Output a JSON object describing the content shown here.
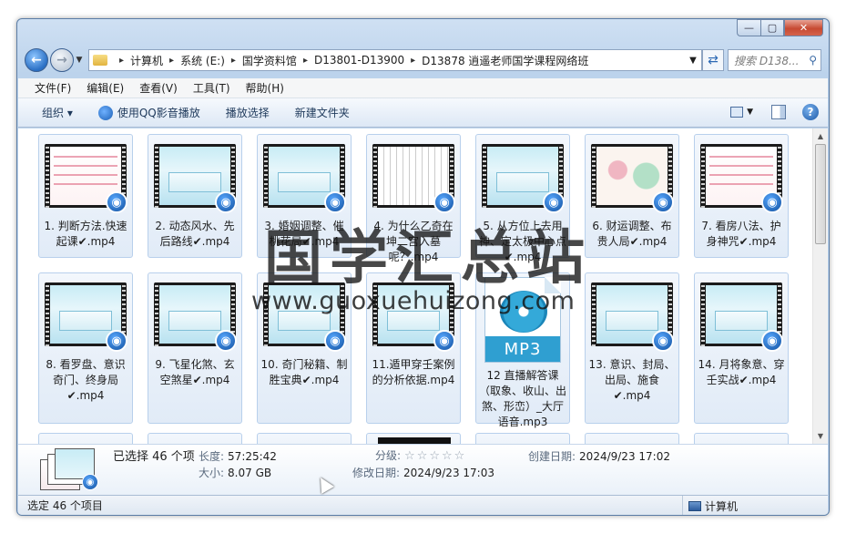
{
  "window": {
    "min_glyph": "—",
    "max_glyph": "▢",
    "close_glyph": "✕"
  },
  "address": {
    "breadcrumbs": [
      "计算机",
      "系统 (E:)",
      "国学资料馆",
      "D13801-D13900",
      "D13878 逍遥老师国学课程网络班"
    ],
    "search_placeholder": "搜索 D138..."
  },
  "menu": [
    "文件(F)",
    "编辑(E)",
    "查看(V)",
    "工具(T)",
    "帮助(H)"
  ],
  "toolbar": {
    "organize": "组织 ▾",
    "qq_play": "使用QQ影音播放",
    "play_selection": "播放选择",
    "new_folder": "新建文件夹"
  },
  "files": [
    {
      "label": "1. 判断方法.快速起课✔.mp4",
      "thumb": "pink"
    },
    {
      "label": "2. 动态风水、先后路线✔.mp4",
      "thumb": "cyan"
    },
    {
      "label": "3. 婚姻调整、催桃花局✔.mp4",
      "thumb": "cyan"
    },
    {
      "label": "4. 为什么乙奇在坤二宫入墓呢？.mp4",
      "thumb": "grid"
    },
    {
      "label": "5. 从方位上去用神、定太极中心点✔.mp4",
      "thumb": "cyan"
    },
    {
      "label": "6. 财运调整、布贵人局✔.mp4",
      "thumb": "pale"
    },
    {
      "label": "7. 看房八法、护身神咒✔.mp4",
      "thumb": "pink"
    },
    {
      "label": "8. 看罗盘、意识奇门、终身局✔.mp4",
      "thumb": "cyan"
    },
    {
      "label": "9. 飞星化煞、玄空煞星✔.mp4",
      "thumb": "cyan"
    },
    {
      "label": "10. 奇门秘籍、制胜宝典✔.mp4",
      "thumb": "cyan"
    },
    {
      "label": "11.遁甲穿壬案例的分析依据.mp4",
      "thumb": "cyan"
    },
    {
      "label": "12 直播解答课（取象、收山、出煞、形峦）_大厅语音.mp3",
      "thumb": "mp3"
    },
    {
      "label": "13. 意识、封局、出局、施食✔.mp4",
      "thumb": "cyan"
    },
    {
      "label": "14. 月将象意、穿壬实战✔.mp4",
      "thumb": "cyan"
    }
  ],
  "mp3_badge": "MP3",
  "details": {
    "selected": "已选择 46 个项",
    "length_label": "长度:",
    "length": "57:25:42",
    "size_label": "大小:",
    "size": "8.07 GB",
    "rating_label": "分级:",
    "rating_stars": "☆☆☆☆☆",
    "modified_label": "修改日期:",
    "modified": "2024/9/23 17:03",
    "created_label": "创建日期:",
    "created": "2024/9/23 17:02"
  },
  "status": {
    "left": "选定 46 个项目",
    "right": "计算机"
  },
  "watermark": {
    "title": "国学汇总站",
    "url": "www.guoxuehuizong.com"
  }
}
